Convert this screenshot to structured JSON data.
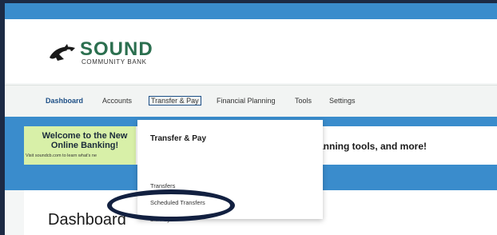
{
  "brand": {
    "name": "SOUND",
    "sub": "COMMUNITY BANK",
    "colors": {
      "green": "#2b6f4f",
      "blue": "#3a8ccc",
      "nav_active": "#1d4f86",
      "ring": "#122040"
    }
  },
  "nav": {
    "items": [
      {
        "label": "Dashboard"
      },
      {
        "label": "Accounts"
      },
      {
        "label": "Transfer & Pay"
      },
      {
        "label": "Financial Planning"
      },
      {
        "label": "Tools"
      },
      {
        "label": "Settings"
      }
    ]
  },
  "promo": {
    "welcome_title": "Welcome to the New Online Banking!",
    "welcome_sub": "Visit soundcb.com to learn what's ne",
    "text": "l Planning tools, and more!"
  },
  "dropdown": {
    "title": "Transfer & Pay",
    "items": [
      {
        "label": "Transfers"
      },
      {
        "label": "Scheduled Transfers"
      },
      {
        "label": "Bill Pay"
      }
    ]
  },
  "main": {
    "title": "Dashboard"
  }
}
